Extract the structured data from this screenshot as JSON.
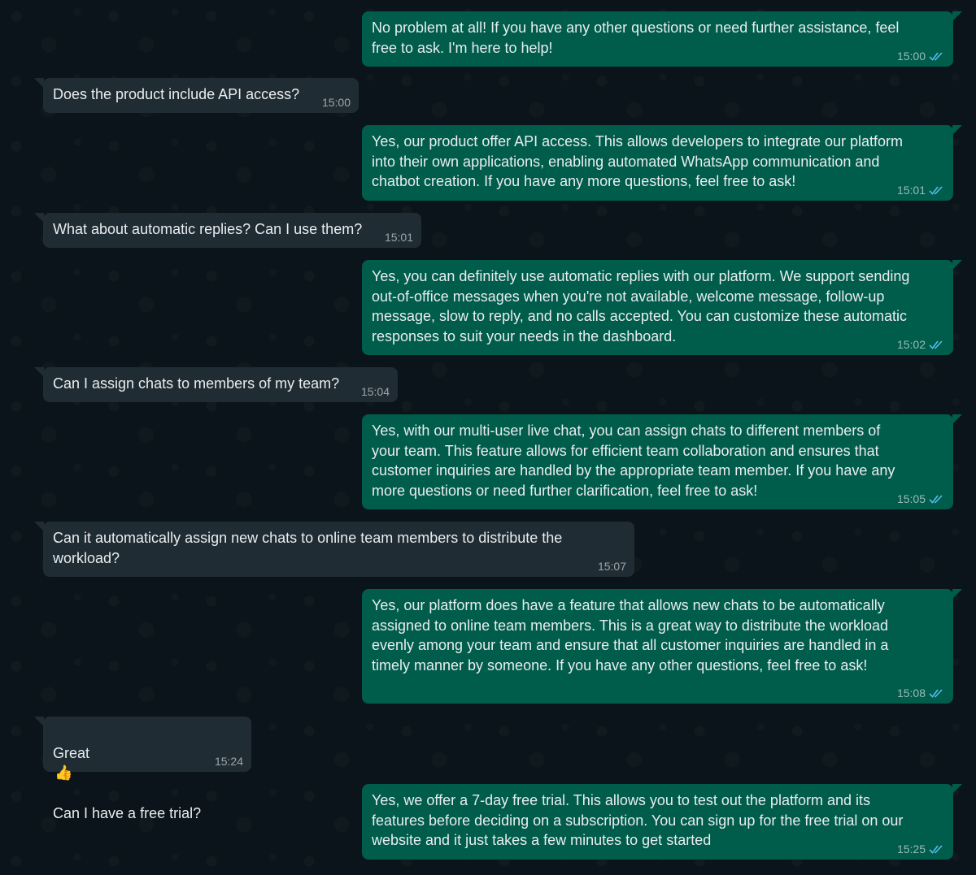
{
  "colors": {
    "background": "#0b141a",
    "incoming_bubble": "#202c33",
    "outgoing_bubble": "#005c4b",
    "text": "#e9edef",
    "read_ticks": "#53bdeb"
  },
  "messages": [
    {
      "direction": "out",
      "text": "No problem at all! If you have any other questions or need further assistance, feel\nfree to ask. I'm here to help!",
      "time": "15:00",
      "status_icon": "double-check-read-icon"
    },
    {
      "direction": "in",
      "text": "Does the product include API access?",
      "time": "15:00"
    },
    {
      "direction": "out",
      "text": "Yes, our product offer API access. This allows developers to integrate our platform\ninto their own applications, enabling automated WhatsApp communication and\nchatbot creation. If you have any more questions, feel free to ask!",
      "time": "15:01",
      "status_icon": "double-check-read-icon"
    },
    {
      "direction": "in",
      "text": "What about automatic replies? Can I use them?",
      "time": "15:01"
    },
    {
      "direction": "out",
      "text": "Yes, you can definitely use automatic replies with our platform. We support sending\nout-of-office messages when you're not available, welcome message, follow-up\nmessage, slow to reply, and no calls accepted. You can customize these automatic\nresponses to suit your needs in the dashboard.",
      "time": "15:02",
      "status_icon": "double-check-read-icon"
    },
    {
      "direction": "in",
      "text": "Can I assign chats to members of my team?",
      "time": "15:04"
    },
    {
      "direction": "out",
      "text": "Yes, with our multi-user live chat, you can assign chats to different members of\nyour team. This feature allows for efficient team collaboration and ensures that\ncustomer inquiries are handled by the appropriate team member. If you have any\nmore questions or need further clarification, feel free to ask!",
      "time": "15:05",
      "status_icon": "double-check-read-icon"
    },
    {
      "direction": "in",
      "text": "Can it automatically assign new chats to online team members to distribute the\nworkload?",
      "time": "15:07"
    },
    {
      "direction": "out",
      "text": "Yes, our platform does have a feature that allows new chats to be automatically\nassigned to online team members. This is a great way to distribute the workload\nevenly among your team and ensure that all customer inquiries are handled in a\ntimely manner by someone. If you have any other questions, feel free to ask!",
      "time": "15:08",
      "status_icon": "double-check-read-icon"
    },
    {
      "direction": "in",
      "text_line1": "Great",
      "emoji": "👍",
      "emoji_icon": "thumbs-up-emoji-icon",
      "text_line2": "Can I have a free trial?",
      "time": "15:24"
    },
    {
      "direction": "out",
      "text": "Yes, we offer a 7-day free trial. This allows you to test out the platform and its\nfeatures before deciding on a subscription. You can sign up for the free trial on our\nwebsite and it just takes a few minutes to get started",
      "time": "15:25",
      "status_icon": "double-check-read-icon"
    }
  ]
}
